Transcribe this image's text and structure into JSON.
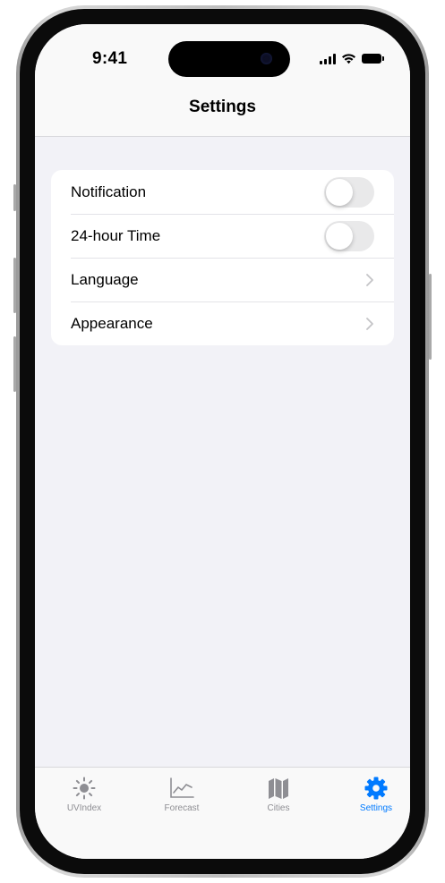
{
  "status_bar": {
    "time": "9:41"
  },
  "header": {
    "title": "Settings"
  },
  "settings": {
    "rows": [
      {
        "label": "Notification",
        "control": "toggle",
        "on": false
      },
      {
        "label": "24-hour Time",
        "control": "toggle",
        "on": false
      },
      {
        "label": "Language",
        "control": "chevron-right-icon"
      },
      {
        "label": "Appearance",
        "control": "chevron-right-icon"
      }
    ]
  },
  "tab_bar": {
    "tabs": [
      {
        "label": "UVIndex",
        "icon": "sun-icon",
        "active": false
      },
      {
        "label": "Forecast",
        "icon": "line-chart-icon",
        "active": false
      },
      {
        "label": "Cities",
        "icon": "map-icon",
        "active": false
      },
      {
        "label": "Settings",
        "icon": "gear-icon",
        "active": true
      }
    ]
  },
  "colors": {
    "accent": "#007aff",
    "inactive_tab": "#8e8e93",
    "background": "#f2f2f7",
    "toggle_off": "#e9e9ea"
  }
}
